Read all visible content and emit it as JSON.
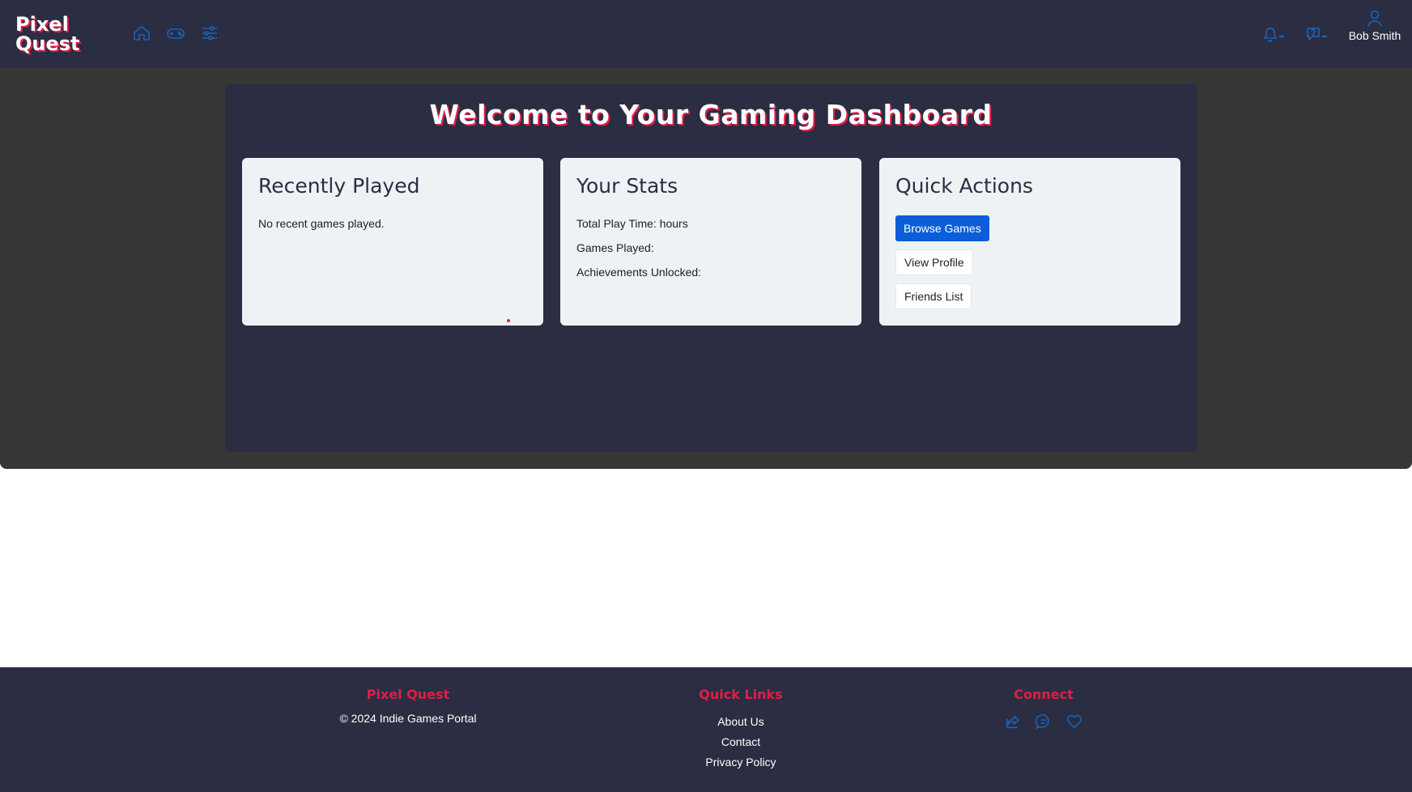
{
  "header": {
    "logo_line1": "Pixel",
    "logo_line2": "Quest",
    "nav_icons": [
      "home-icon",
      "gamepad-icon",
      "sliders-icon"
    ],
    "notification_icon": "bell-icon",
    "help_icon": "help-icon",
    "user_name": "Bob Smith",
    "accent": "#1565c0"
  },
  "main": {
    "title": "Welcome to Your Gaming Dashboard",
    "recently_played": {
      "heading": "Recently Played",
      "empty_text": "No recent games played."
    },
    "stats": {
      "heading": "Your Stats",
      "play_time": "Total Play Time: hours",
      "games_played": "Games Played:",
      "achievements": "Achievements Unlocked:"
    },
    "quick_actions": {
      "heading": "Quick Actions",
      "browse": "Browse Games",
      "profile": "View Profile",
      "friends": "Friends List"
    }
  },
  "footer": {
    "brand_heading": "Pixel Quest",
    "copyright": "© 2024 Indie Games Portal",
    "links_heading": "Quick Links",
    "links": [
      "About Us",
      "Contact",
      "Privacy Policy"
    ],
    "connect_heading": "Connect",
    "social_icons": [
      "share-icon",
      "chat-icon",
      "heart-icon"
    ]
  },
  "colors": {
    "navy": "#2b2d42",
    "red_accent": "#e11d48",
    "card_bg": "#edf2f4",
    "primary_button": "#0b5ed7",
    "icon_blue": "#1565c0"
  }
}
